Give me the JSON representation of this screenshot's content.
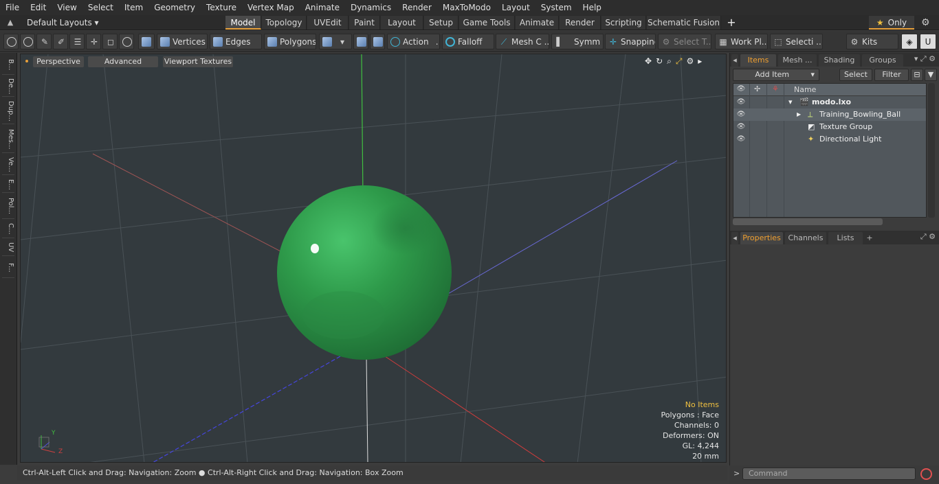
{
  "menu": [
    "File",
    "Edit",
    "View",
    "Select",
    "Item",
    "Geometry",
    "Texture",
    "Vertex Map",
    "Animate",
    "Dynamics",
    "Render",
    "MaxToModo",
    "Layout",
    "System",
    "Help"
  ],
  "layout_bar": {
    "layouts_label": "Default Layouts",
    "tabs": [
      "Model",
      "Topology",
      "UVEdit",
      "Paint",
      "Layout",
      "Setup",
      "Game Tools",
      "Animate",
      "Render",
      "Scripting",
      "Schematic Fusion"
    ],
    "active_tab": "Model",
    "only_label": "Only"
  },
  "toolbar": {
    "vertices": "Vertices",
    "edges": "Edges",
    "polygons": "Polygons",
    "action": "Action",
    "falloff": "Falloff",
    "mesh_c": "Mesh C ...",
    "symm": "Symm ...",
    "snapping": "Snapping",
    "select_t": "Select T...",
    "work_pl": "Work Pl...",
    "selecti": "Selecti ...",
    "kits": "Kits"
  },
  "left_tabs": [
    "B...",
    "De...",
    "Dup...",
    "Mes...",
    "Ve...",
    "E...",
    "Pol...",
    "C...",
    "UV",
    "F..."
  ],
  "viewport": {
    "perspective": "Perspective",
    "advanced": "Advanced",
    "viewport_textures": "Viewport Textures",
    "stats": {
      "no_items": "No Items",
      "polygons": "Polygons : Face",
      "channels": "Channels: 0",
      "deformers": "Deformers: ON",
      "gl": "GL: 4,244",
      "unit": "20 mm"
    },
    "axis_y": "Y",
    "axis_z": "Z"
  },
  "status_bar": {
    "hint1": "Ctrl-Alt-Left Click and Drag: Navigation: Zoom",
    "hint2": "Ctrl-Alt-Right Click and Drag: Navigation: Box Zoom"
  },
  "right_panel": {
    "tabs": [
      "Items",
      "Mesh ...",
      "Shading",
      "Groups"
    ],
    "add_item": "Add Item",
    "select": "Select",
    "filter": "Filter",
    "name_col": "Name",
    "tree": [
      {
        "label": "modo.lxo",
        "icon": "scene-icon"
      },
      {
        "label": "Training_Bowling_Ball",
        "icon": "mesh-icon"
      },
      {
        "label": "Texture Group",
        "icon": "texture-group-icon"
      },
      {
        "label": "Directional Light",
        "icon": "light-icon"
      }
    ],
    "props_tabs": [
      "Properties",
      "Channels",
      "Lists"
    ],
    "command_placeholder": "Command"
  },
  "colors": {
    "accent": "#e8a03a",
    "ball": "#2e9a4a",
    "viewport_bg": "#333a3e"
  }
}
